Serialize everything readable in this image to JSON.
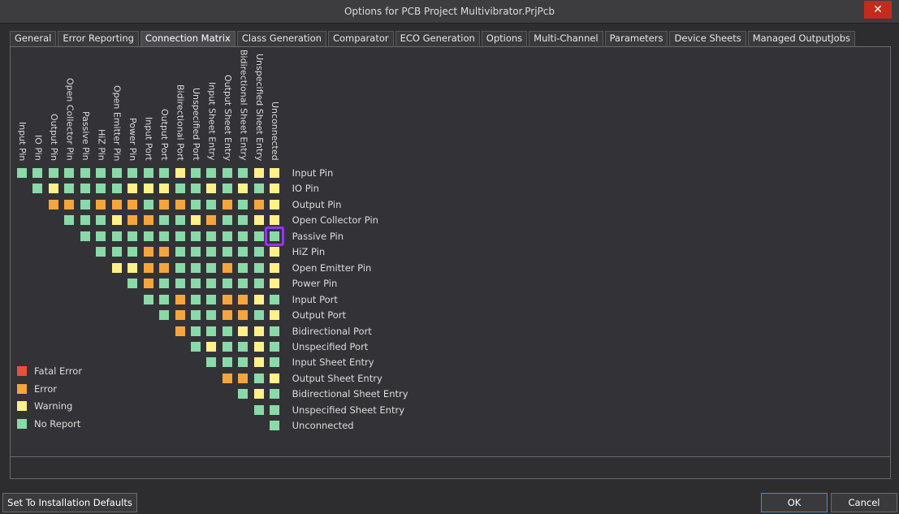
{
  "window": {
    "title": "Options for PCB Project Multivibrator.PrjPcb",
    "close_glyph": "✕"
  },
  "tabs": [
    {
      "label": "General"
    },
    {
      "label": "Error Reporting"
    },
    {
      "label": "Connection Matrix"
    },
    {
      "label": "Class Generation"
    },
    {
      "label": "Comparator"
    },
    {
      "label": "ECO Generation"
    },
    {
      "label": "Options"
    },
    {
      "label": "Multi-Channel"
    },
    {
      "label": "Parameters"
    },
    {
      "label": "Device Sheets"
    },
    {
      "label": "Managed OutputJobs"
    }
  ],
  "active_tab": "Connection Matrix",
  "colors": {
    "Fatal Error": "#e8503a",
    "Error": "#f5a53d",
    "Warning": "#fff08a",
    "No Report": "#8ad9a8"
  },
  "matrix": {
    "labels": [
      "Input Pin",
      "IO Pin",
      "Output Pin",
      "Open Collector Pin",
      "Passive Pin",
      "HiZ Pin",
      "Open Emitter Pin",
      "Power Pin",
      "Input Port",
      "Output Port",
      "Bidirectional Port",
      "Unspecified Port",
      "Input Sheet Entry",
      "Output Sheet Entry",
      "Bidirectional Sheet Entry",
      "Unspecified Sheet Entry",
      "Unconnected"
    ],
    "legend_codes": {
      "N": "No Report",
      "W": "Warning",
      "E": "Error",
      "F": "Fatal Error"
    },
    "rows": [
      "NNNNNNNNNNWNNNNWW",
      "NWNNNNWWWNNWNWNWN",
      "EENEEENEENNENEWN",
      "NNNWEENNWENNWWN",
      "NNNNNNNNNNNNNN",
      "NNNEENNNNNNWN",
      "WWEENNNENNWN",
      "NENNNNNNNWN",
      "NNENNEEWN",
      "NENNEENWN",
      "ENNNWWN",
      "NWNNWN",
      "NNNWN",
      "EENWN",
      "NWN",
      "NN",
      "N"
    ],
    "highlighted_cell": {
      "row": "Passive Pin",
      "col": "Unconnected"
    }
  },
  "legend": [
    {
      "label": "Fatal Error",
      "color": "#e8503a"
    },
    {
      "label": "Error",
      "color": "#f5a53d"
    },
    {
      "label": "Warning",
      "color": "#fff08a"
    },
    {
      "label": "No Report",
      "color": "#8ad9a8"
    }
  ],
  "buttons": {
    "defaults": "Set To Installation Defaults",
    "ok": "OK",
    "cancel": "Cancel"
  }
}
